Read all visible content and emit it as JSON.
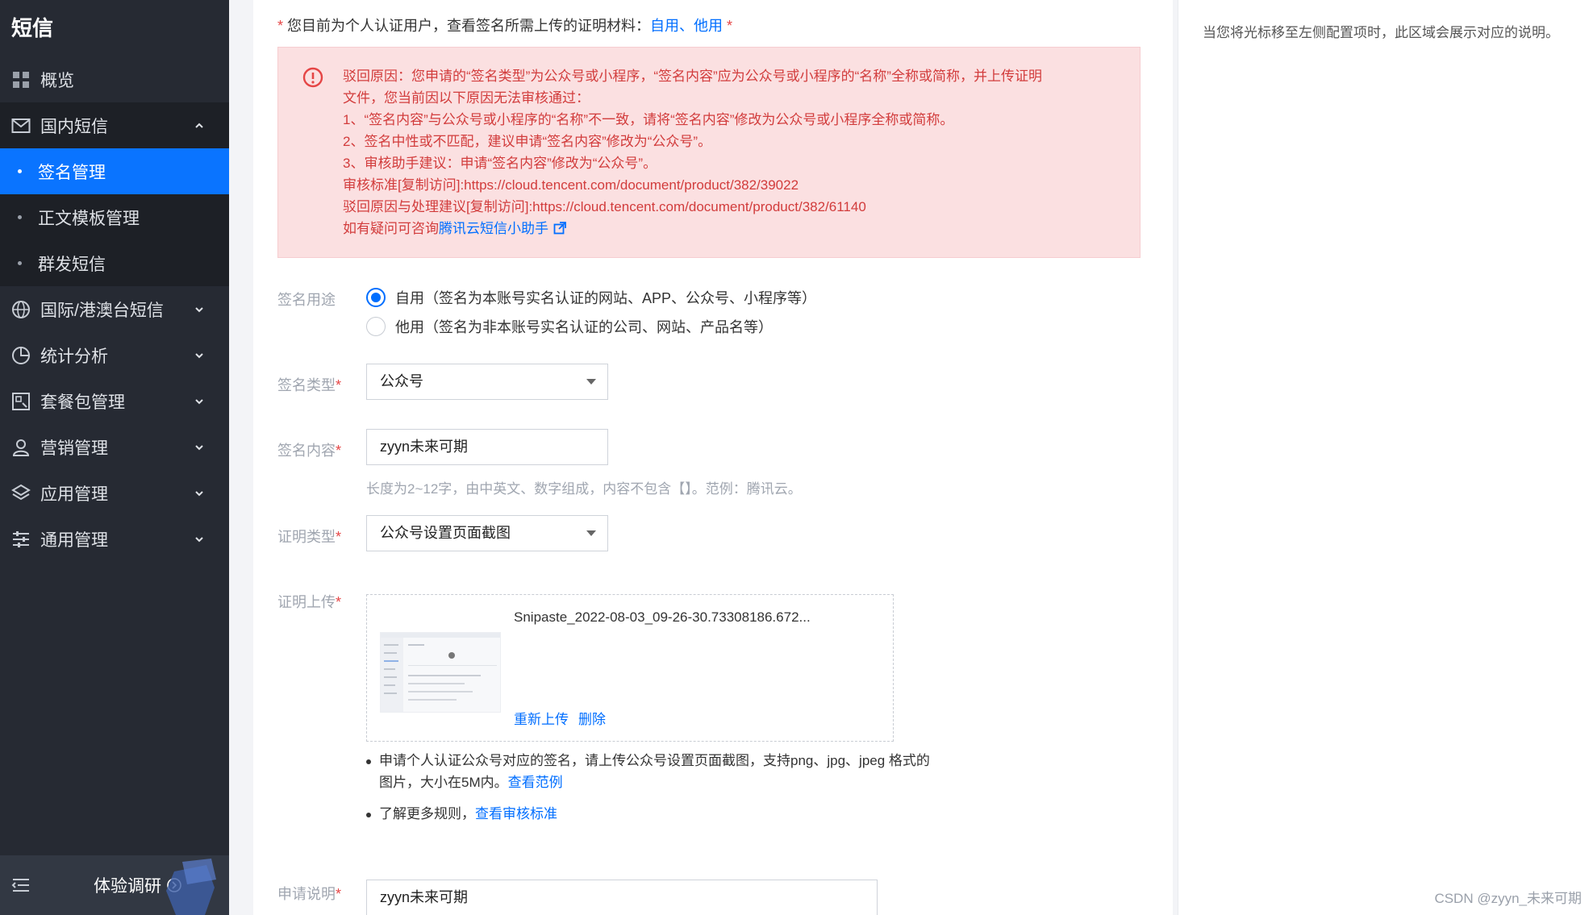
{
  "sidebar": {
    "title": "短信",
    "items": [
      {
        "label": "概览",
        "icon": "overview-icon"
      },
      {
        "label": "国内短信",
        "icon": "mail-icon"
      },
      {
        "label": "国际/港澳台短信",
        "icon": "globe-icon"
      },
      {
        "label": "统计分析",
        "icon": "pie-chart-icon"
      },
      {
        "label": "套餐包管理",
        "icon": "package-icon"
      },
      {
        "label": "营销管理",
        "icon": "user-icon"
      },
      {
        "label": "应用管理",
        "icon": "layers-icon"
      },
      {
        "label": "通用管理",
        "icon": "sliders-icon"
      }
    ],
    "subitems": [
      {
        "label": "签名管理",
        "active": true
      },
      {
        "label": "正文模板管理",
        "active": false
      },
      {
        "label": "群发短信",
        "active": false
      }
    ],
    "footer": {
      "survey_label": "体验调研"
    }
  },
  "notice": {
    "star": "*",
    "text": "您目前为个人认证用户，查看签名所需上传的证明材料：",
    "link1": "自用",
    "sep": "、",
    "link2": "他用",
    "star2": "*"
  },
  "reject": {
    "lines": [
      "驳回原因：您申请的“签名类型”为公众号或小程序，“签名内容”应为公众号或小程序的“名称”全称或简称，并上传证明",
      "文件，您当前因以下原因无法审核通过：",
      "1、“签名内容”与公众号或小程序的“名称”不一致，请将“签名内容”修改为公众号或小程序全称或简称。",
      "2、签名中性或不匹配，建议申请“签名内容”修改为“公众号”。",
      "3、审核助手建议：申请“签名内容”修改为“公众号”。",
      "审核标准[复制访问]:https://cloud.tencent.com/document/product/382/39022",
      "驳回原因与处理建议[复制访问]:https://cloud.tencent.com/document/product/382/61140"
    ],
    "consult_prefix": "如有疑问可咨询",
    "consult_link": "腾讯云短信小助手"
  },
  "form": {
    "usage": {
      "label": "签名用途",
      "options": [
        {
          "label": "自用（签名为本账号实名认证的网站、APP、公众号、小程序等）",
          "checked": true
        },
        {
          "label": "他用（签名为非本账号实名认证的公司、网站、产品名等）",
          "checked": false
        }
      ]
    },
    "sign_type": {
      "label": "签名类型",
      "star": "*",
      "value": "公众号"
    },
    "sign_content": {
      "label": "签名内容",
      "star": "*",
      "value": "zyyn未来可期",
      "hint": "长度为2~12字，由中英文、数字组成，内容不包含【】。范例：腾讯云。"
    },
    "cert_type": {
      "label": "证明类型",
      "star": "*",
      "value": "公众号设置页面截图"
    },
    "cert_upload": {
      "label": "证明上传",
      "star": "*",
      "file_name": "Snipaste_2022-08-03_09-26-30.73308186.672...",
      "reupload": "重新上传",
      "delete": "删除"
    },
    "bullets": {
      "b1_text": "申请个人认证公众号对应的签名，请上传公众号设置页面截图，支持png、jpg、jpeg 格式的图片，大小在5M内。",
      "b1_link": "查看范例",
      "b2_text": "了解更多规则，",
      "b2_link": "查看审核标准"
    },
    "apply_desc": {
      "label": "申请说明",
      "star": "*",
      "value": "zyyn未来可期"
    }
  },
  "right_panel": {
    "tip": "当您将光标移至左侧配置项时，此区域会展示对应的说明。"
  },
  "watermark": "CSDN @zyyn_未来可期",
  "colors": {
    "accent": "#006eff",
    "sidebar_bg": "#262a33",
    "active_bg": "#0a74ff",
    "error": "#d23c3c",
    "error_bg": "#fbe0e1"
  }
}
